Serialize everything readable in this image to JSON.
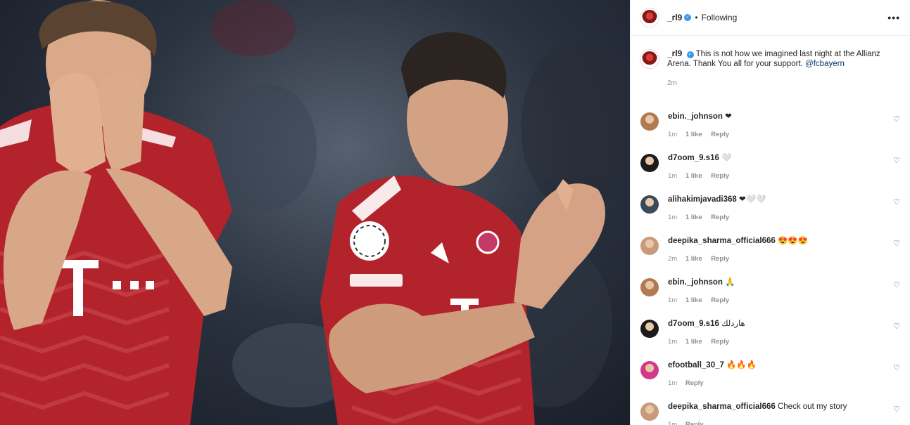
{
  "post": {
    "author": "_rl9",
    "follow_status": "Following",
    "more_label": "•••",
    "caption": {
      "text": "This is not how we imagined last night at the Allianz Arena. Thank You all for your support.",
      "mention": "@fcbayern",
      "time": "2m"
    }
  },
  "comments": [
    {
      "user": "ebin._johnson",
      "text": "❤",
      "time": "1m",
      "likes": "1 like",
      "reply": "Reply",
      "avatar_color": "#b07a52"
    },
    {
      "user": "d7oom_9.s16",
      "text": "🤍",
      "time": "1m",
      "likes": "1 like",
      "reply": "Reply",
      "avatar_color": "#1b1b1b"
    },
    {
      "user": "alihakimjavadi368",
      "text": "❤🤍🤍",
      "time": "1m",
      "likes": "1 like",
      "reply": "Reply",
      "avatar_color": "#3a4a5c"
    },
    {
      "user": "deepika_sharma_official666",
      "text": "😍😍😍",
      "time": "2m",
      "likes": "1 like",
      "reply": "Reply",
      "avatar_color": "#c79a7a"
    },
    {
      "user": "ebin._johnson",
      "text": "🙏",
      "time": "1m",
      "likes": "1 like",
      "reply": "Reply",
      "avatar_color": "#b07a52"
    },
    {
      "user": "d7oom_9.s16",
      "text": "هاردلك",
      "time": "1m",
      "likes": "1 like",
      "reply": "Reply",
      "avatar_color": "#1b1b1b"
    },
    {
      "user": "efootball_30_7",
      "text": "🔥🔥🔥",
      "time": "1m",
      "likes": "",
      "reply": "Reply",
      "avatar_color": "#d13a8c"
    },
    {
      "user": "deepika_sharma_official666",
      "text": "Check out my story",
      "time": "1m",
      "likes": "",
      "reply": "Reply",
      "avatar_color": "#c79a7a"
    }
  ],
  "icons": {
    "heart": "♡",
    "verified": "✓"
  }
}
